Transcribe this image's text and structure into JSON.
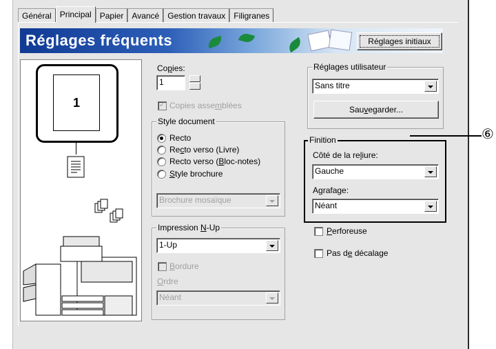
{
  "tabs": [
    "Général",
    "Principal",
    "Papier",
    "Avancé",
    "Gestion travaux",
    "Filigranes"
  ],
  "banner": {
    "title": "Réglages fréquents",
    "reset_button": "Réglages initiaux"
  },
  "preview": {
    "page_number": "1"
  },
  "copies": {
    "label_prefix": "Co",
    "label_ul": "p",
    "label_suffix": "ies:",
    "value": "1"
  },
  "collate": {
    "label_prefix": "Copies asse",
    "label_ul": "m",
    "label_suffix": "blées"
  },
  "style_document": {
    "title": "Style document",
    "opt1": "Recto",
    "opt2_prefix": "Re",
    "opt2_ul": "c",
    "opt2_suffix": "to verso (Livre)",
    "opt3_prefix": "Recto verso (",
    "opt3_ul": "B",
    "opt3_suffix": "loc-notes)",
    "opt4_ul": "S",
    "opt4_suffix": "tyle brochure",
    "brochure_select": "Brochure mosaïque"
  },
  "nup": {
    "title_prefix": "Impression ",
    "title_ul": "N",
    "title_suffix": "-Up",
    "value": "1-Up",
    "border_ul": "B",
    "border_suffix": "ordure",
    "order_ul": "O",
    "order_suffix": "rdre",
    "order_value": "Néant"
  },
  "user_settings": {
    "title": "Réglages utilisateur",
    "value": "Sans titre",
    "save_prefix": "Sau",
    "save_ul": "v",
    "save_suffix": "egarder..."
  },
  "finition": {
    "title": "Finition",
    "binding_prefix": "Côté de la re",
    "binding_ul": "l",
    "binding_suffix": "iure:",
    "binding_value": "Gauche",
    "staple_prefix": "A",
    "staple_ul": "g",
    "staple_suffix": "rafage:",
    "staple_value": "Néant"
  },
  "punch": {
    "ul": "P",
    "suffix": "erforeuse"
  },
  "offset": {
    "prefix": "Pas d",
    "ul": "e",
    "suffix": " décalage"
  },
  "callout": "⑥"
}
